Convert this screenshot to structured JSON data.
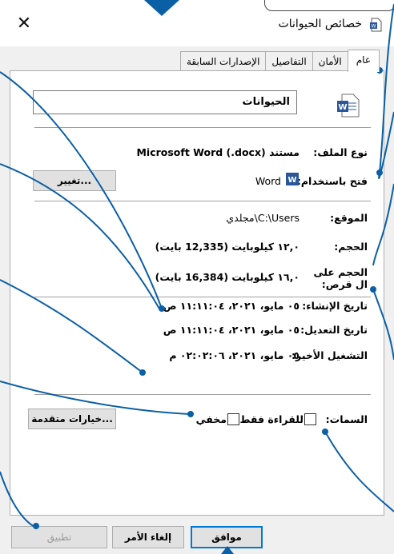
{
  "window": {
    "title": "خصائص الحيوانات",
    "close_glyph": "✕"
  },
  "tabs": [
    {
      "label": "عام"
    },
    {
      "label": "الأمان"
    },
    {
      "label": "التفاصيل"
    },
    {
      "label": "الإصدارات السابقة"
    }
  ],
  "general": {
    "file_name": "الحيوانات",
    "type_label": "نوع الملف:",
    "type_value": "مستند Microsoft Word (.docx)",
    "opens_label": "فتح باستخدام:",
    "opens_value": "Word",
    "change_button": "تغيير...",
    "location_label": "الموقع:",
    "location_value": "C:\\Users\\مجلدي",
    "size_label": "الحجم:",
    "size_value": "١٢,٠ كيلوبايت (12,335 بايت)",
    "size_on_disk_label": "الحجم على ال قرص:",
    "size_on_disk_value": "١٦,٠ كيلوبايت (16,384 بايت)",
    "created_label": "تاريخ الإنشاء:",
    "created_value": "٠٥ مايو، ٢٠٢١، ١١:١١:٠٤ ص",
    "modified_label": "تاريخ التعديل:",
    "modified_value": "٠٥ مايو، ٢٠٢١، ١١:١١:٠٤ ص",
    "accessed_label": "التشغيل الأخير:",
    "accessed_value": "٠٥ مايو، ٢٠٢١، ٠٢:٠٢:٠٦ م",
    "attributes_label": "السمات:",
    "readonly_label": "للقراءة فقط",
    "hidden_label": "مخفي",
    "advanced_button": "خيارات متقدمة..."
  },
  "footer": {
    "ok": "موافق",
    "cancel": "إلغاء الأمر",
    "apply": "تطبيق"
  },
  "colors": {
    "annotation": "#0b5fa5",
    "word_blue": "#2b579a",
    "accent": "#0078d7"
  }
}
